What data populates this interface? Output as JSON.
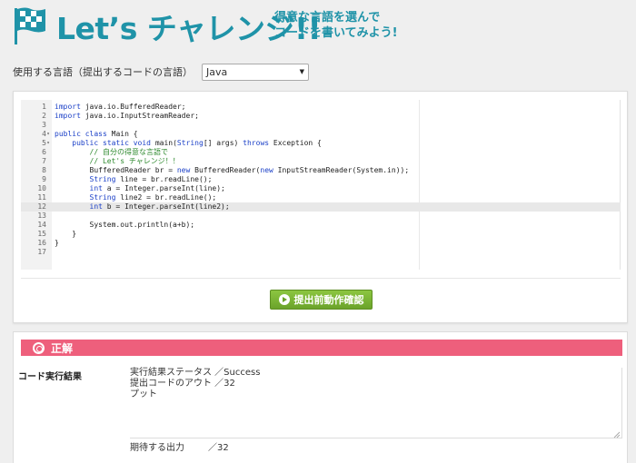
{
  "header": {
    "title": "Let’s チャレンジ!!",
    "subtitle_line1": "得意な言語を選んで",
    "subtitle_line2": "コードを書いてみよう!"
  },
  "language": {
    "label": "使用する言語（提出するコードの言語）",
    "selected": "Java"
  },
  "editor": {
    "lines": [
      {
        "n": "1",
        "fold": "",
        "code": "import java.io.BufferedReader;"
      },
      {
        "n": "2",
        "fold": "",
        "code": "import java.io.InputStreamReader;"
      },
      {
        "n": "3",
        "fold": "",
        "code": ""
      },
      {
        "n": "4",
        "fold": "▾",
        "code": "public class Main {"
      },
      {
        "n": "5",
        "fold": "▾",
        "code": "    public static void main(String[] args) throws Exception {"
      },
      {
        "n": "6",
        "fold": "",
        "code": "        // 自分の得意な言語で"
      },
      {
        "n": "7",
        "fold": "",
        "code": "        // Let's チャレンジ！！"
      },
      {
        "n": "8",
        "fold": "",
        "code": "        BufferedReader br = new BufferedReader(new InputStreamReader(System.in));"
      },
      {
        "n": "9",
        "fold": "",
        "code": "        String line = br.readLine();"
      },
      {
        "n": "10",
        "fold": "",
        "code": "        int a = Integer.parseInt(line);"
      },
      {
        "n": "11",
        "fold": "",
        "code": "        String line2 = br.readLine();"
      },
      {
        "n": "12",
        "fold": "",
        "code": "        int b = Integer.parseInt(line2);"
      },
      {
        "n": "13",
        "fold": "",
        "code": ""
      },
      {
        "n": "14",
        "fold": "",
        "code": "        System.out.println(a+b);"
      },
      {
        "n": "15",
        "fold": "",
        "code": "    }"
      },
      {
        "n": "16",
        "fold": "",
        "code": "}"
      },
      {
        "n": "17",
        "fold": "",
        "code": ""
      }
    ],
    "active_line": "12"
  },
  "run_button": "提出前動作確認",
  "result": {
    "title": "正解",
    "exec_label": "コード実行結果",
    "status_line": "実行結果ステータス ／Success",
    "output_line1": "提出コードのアウト ／32",
    "output_line2": "プット",
    "expected_label": "期待する出力",
    "expected_value": "／32"
  },
  "colors": {
    "brand": "#1f93a8",
    "success_bar": "#ee5f7c",
    "run_button": "#7ab536",
    "keyword": "#1a3fc7",
    "comment": "#2f8a2f"
  }
}
